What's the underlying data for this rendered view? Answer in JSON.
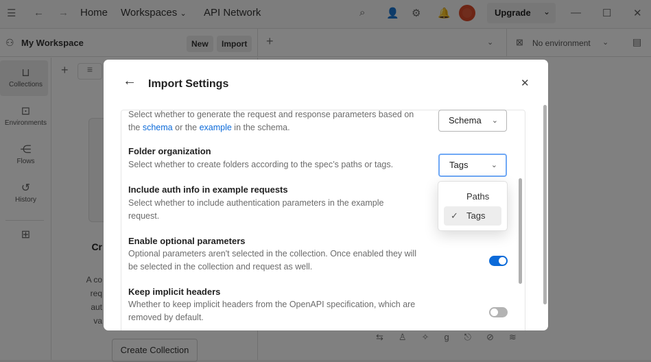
{
  "topbar": {
    "home": "Home",
    "workspaces": "Workspaces",
    "api_network": "API Network",
    "upgrade": "Upgrade"
  },
  "workspace": {
    "name": "My Workspace",
    "new_label": "New",
    "import_label": "Import",
    "environment": "No environment"
  },
  "leftnav": {
    "items": [
      {
        "label": "Collections",
        "icon": "trash-bin-icon"
      },
      {
        "label": "Environments",
        "icon": "environment-icon"
      },
      {
        "label": "Flows",
        "icon": "flows-icon"
      },
      {
        "label": "History",
        "icon": "history-icon"
      }
    ]
  },
  "background": {
    "heading_fragment": "Cr",
    "text_fragments": [
      "A co",
      "req",
      "aut",
      "va"
    ],
    "create_collection": "Create Collection"
  },
  "modal": {
    "title": "Import Settings",
    "sections": [
      {
        "desc_pre": "Select whether to generate the request and response parameters based on the ",
        "link1": "schema",
        "desc_mid": " or the ",
        "link2": "example",
        "desc_post": " in the schema.",
        "select": "Schema"
      },
      {
        "title": "Folder organization",
        "desc": "Select whether to create folders according to the spec’s paths or tags.",
        "select": "Tags"
      },
      {
        "title": "Include auth info in example requests",
        "desc": "Select whether to include authentication parameters in the example request.",
        "enabled": true
      },
      {
        "title": "Enable optional parameters",
        "desc": "Optional parameters aren't selected in the collection. Once enabled they will be selected in the collection and request as well.",
        "enabled": true
      },
      {
        "title": "Keep implicit headers",
        "desc": "Whether to keep implicit headers from the OpenAPI specification, which are removed by default.",
        "enabled": false
      }
    ],
    "dropdown": {
      "options": [
        "Paths",
        "Tags"
      ],
      "selected": "Tags"
    }
  },
  "colors": {
    "accent": "#0b6ad9",
    "focus": "#6fa8f5",
    "toggle_off": "#b3b3b3"
  }
}
